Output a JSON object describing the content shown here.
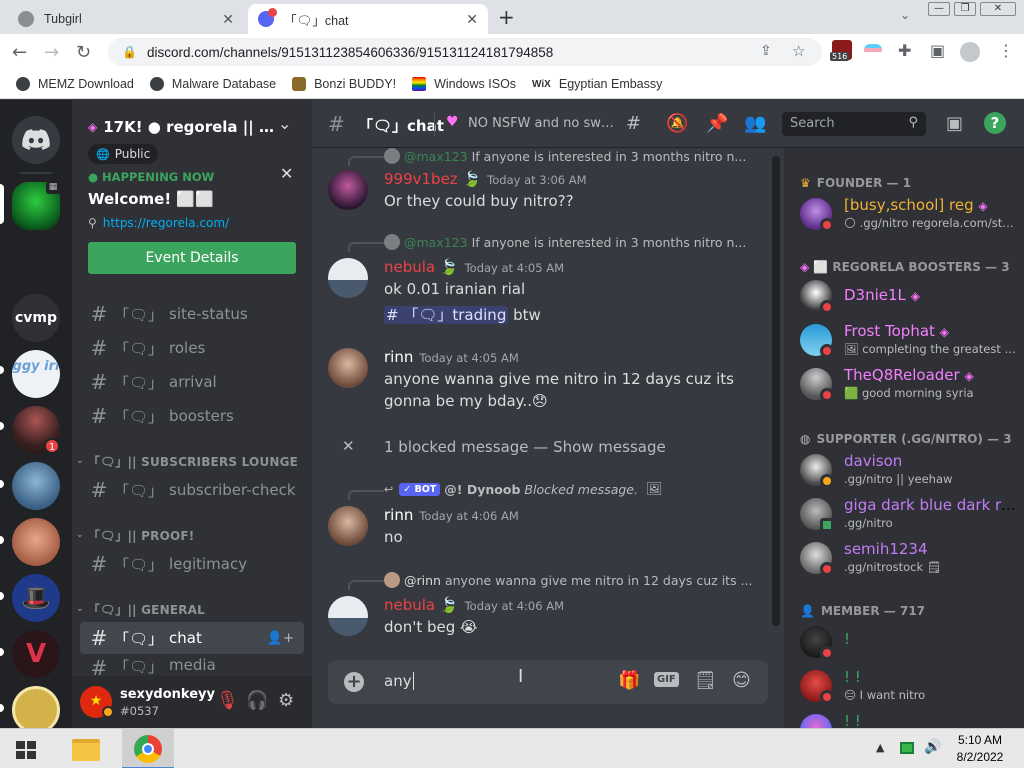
{
  "browser": {
    "tabs": [
      {
        "title": "Tubgirl"
      },
      {
        "title": "「🗨」chat"
      }
    ],
    "new_tab": "+",
    "url": "discord.com/channels/915131123854606336/915131124181794858",
    "extension_badge": "516",
    "bookmarks": [
      "MEMZ Download",
      "Malware Database",
      "Bonzi BUDDY!",
      "Windows ISOs",
      "Egyptian Embassy"
    ]
  },
  "server": {
    "name": "17K! ● regorela || .gg/...",
    "event": {
      "badge": "Public",
      "status": "HAPPENING NOW",
      "title": "Welcome! ⬜⬜",
      "link": "https://regorela.com/",
      "button": "Event Details"
    },
    "channels_top": [
      {
        "prefix": "「🗨」",
        "name": "site-status"
      },
      {
        "prefix": "「🗨」",
        "name": "roles"
      },
      {
        "prefix": "「🗨」",
        "name": "arrival"
      },
      {
        "prefix": "「🗨」",
        "name": "boosters"
      }
    ],
    "categories": [
      {
        "label": "「🗨」|| SUBSCRIBERS LOUNGE",
        "channels": [
          {
            "prefix": "「🗨」",
            "name": "subscriber-check"
          }
        ]
      },
      {
        "label": "「🗨」|| PROOF!",
        "channels": [
          {
            "prefix": "「🗨」",
            "name": "legitimacy"
          }
        ]
      },
      {
        "label": "「🗨」|| GENERAL",
        "channels": [
          {
            "prefix": "「🗨」",
            "name": "chat"
          },
          {
            "prefix": "「🗨」",
            "name": "media"
          }
        ]
      }
    ]
  },
  "guilds": {
    "cvmp": "cvmp",
    "ggy": "ggy irl",
    "badge": "1"
  },
  "user": {
    "name": "sexydonkeyy",
    "tag": "#0537"
  },
  "header": {
    "channel": "「🗨」chat",
    "topic": "NO NSFW and no swea...",
    "search_placeholder": "Search"
  },
  "messages": [
    {
      "reply_to": "@max123",
      "reply_text": "If anyone is interested in 3 months nitro n...",
      "author": "999v1bez",
      "author_color": "#ed4245",
      "time": "Today at 3:06 AM",
      "lines": [
        "Or they could buy nitro??"
      ]
    },
    {
      "reply_to": "@max123",
      "reply_text": "If anyone is interested in 3 months nitro n...",
      "author": "nebula",
      "author_color": "#ed4245",
      "time": "Today at 4:05 AM",
      "lines": [
        "ok 0.01 iranian rial"
      ],
      "mention_channel": "# 「🗨」trading",
      "mention_after": "btw"
    },
    {
      "author": "rinn",
      "author_color": "#ffffff",
      "time": "Today at 4:05 AM",
      "lines": [
        "anyone wanna give me nitro in 12 days cuz its",
        "gonna be my bday..😞"
      ]
    },
    {
      "blocked": "1 blocked message",
      "show": "— Show message"
    },
    {
      "reply_bot_badge": "✓ BOT",
      "reply_to": "@! Dynoob",
      "reply_text": "Blocked message.",
      "author": "rinn",
      "author_color": "#ffffff",
      "time": "Today at 4:06 AM",
      "lines": [
        "no"
      ]
    },
    {
      "reply_to": "@rinn",
      "reply_text": "anyone wanna give me nitro in 12 days cuz its ...",
      "author": "nebula",
      "author_color": "#ed4245",
      "time": "Today at 4:06 AM",
      "lines": [
        "don't beg 😭"
      ]
    }
  ],
  "composer": {
    "value": "any",
    "gif": "GIF"
  },
  "members": {
    "groups": [
      {
        "label": "FOUNDER — 1",
        "icon": "crown-icon",
        "members": [
          {
            "name": "[busy,school] reg",
            "color": "#f0b232",
            "status": "🌕 .gg/nitro regorela.com/sta...",
            "presence": "dnd"
          }
        ]
      },
      {
        "label": "⬜ REGORELA BOOSTERS — 3",
        "icon": "boost-icon",
        "members": [
          {
            "name": "D3nie1L",
            "color": "#f47fff",
            "status": "",
            "presence": "dnd"
          },
          {
            "name": "Frost Tophat",
            "color": "#f47fff",
            "status": "🖼 completing the greatest pl...",
            "presence": "dnd"
          },
          {
            "name": "TheQ8Reloader",
            "color": "#f47fff",
            "status": "🟩 good morning syria",
            "presence": "dnd"
          }
        ]
      },
      {
        "label": "SUPPORTER (.GG/NITRO) — 3",
        "icon": "supporter-icon",
        "members": [
          {
            "name": "davison",
            "color": "#c27cf4",
            "status": ".gg/nitro || yeehaw",
            "presence": "idle"
          },
          {
            "name": "giga dark blue dark re...",
            "color": "#c27cf4",
            "status": ".gg/nitro",
            "presence": "mobile"
          },
          {
            "name": "semih1234",
            "color": "#c27cf4",
            "status": ".gg/nitrostock 🗒",
            "presence": "dnd"
          }
        ]
      },
      {
        "label": "MEMBER — 717",
        "icon": "member-icon",
        "members": [
          {
            "name": "!",
            "color": "#3ba55d",
            "status": "",
            "presence": "dnd"
          },
          {
            "name": "! !",
            "color": "#3ba55d",
            "status": "😑 I want nitro",
            "presence": "dnd"
          },
          {
            "name": "! !",
            "color": "#3ba55d",
            "status": "",
            "presence": "dnd"
          }
        ]
      }
    ]
  },
  "taskbar": {
    "time": "5:10 AM",
    "date": "8/2/2022"
  },
  "colors": {
    "accent": "#3ba55d",
    "brand": "#5865f2",
    "dnd": "#ed4245",
    "idle": "#faa81a",
    "online": "#3ba55d"
  }
}
